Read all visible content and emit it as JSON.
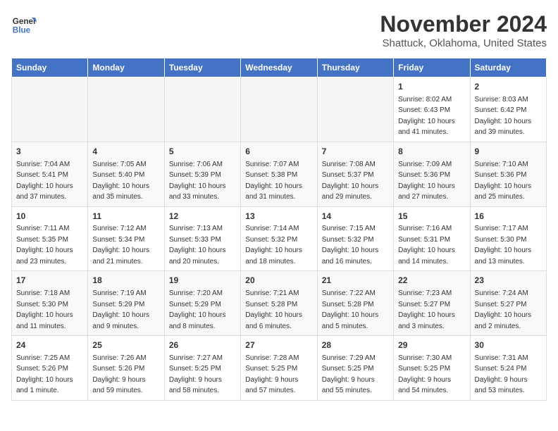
{
  "header": {
    "logo_line1": "General",
    "logo_line2": "Blue",
    "month": "November 2024",
    "location": "Shattuck, Oklahoma, United States"
  },
  "weekdays": [
    "Sunday",
    "Monday",
    "Tuesday",
    "Wednesday",
    "Thursday",
    "Friday",
    "Saturday"
  ],
  "weeks": [
    [
      {
        "day": "",
        "info": ""
      },
      {
        "day": "",
        "info": ""
      },
      {
        "day": "",
        "info": ""
      },
      {
        "day": "",
        "info": ""
      },
      {
        "day": "",
        "info": ""
      },
      {
        "day": "1",
        "info": "Sunrise: 8:02 AM\nSunset: 6:43 PM\nDaylight: 10 hours\nand 41 minutes."
      },
      {
        "day": "2",
        "info": "Sunrise: 8:03 AM\nSunset: 6:42 PM\nDaylight: 10 hours\nand 39 minutes."
      }
    ],
    [
      {
        "day": "3",
        "info": "Sunrise: 7:04 AM\nSunset: 5:41 PM\nDaylight: 10 hours\nand 37 minutes."
      },
      {
        "day": "4",
        "info": "Sunrise: 7:05 AM\nSunset: 5:40 PM\nDaylight: 10 hours\nand 35 minutes."
      },
      {
        "day": "5",
        "info": "Sunrise: 7:06 AM\nSunset: 5:39 PM\nDaylight: 10 hours\nand 33 minutes."
      },
      {
        "day": "6",
        "info": "Sunrise: 7:07 AM\nSunset: 5:38 PM\nDaylight: 10 hours\nand 31 minutes."
      },
      {
        "day": "7",
        "info": "Sunrise: 7:08 AM\nSunset: 5:37 PM\nDaylight: 10 hours\nand 29 minutes."
      },
      {
        "day": "8",
        "info": "Sunrise: 7:09 AM\nSunset: 5:36 PM\nDaylight: 10 hours\nand 27 minutes."
      },
      {
        "day": "9",
        "info": "Sunrise: 7:10 AM\nSunset: 5:36 PM\nDaylight: 10 hours\nand 25 minutes."
      }
    ],
    [
      {
        "day": "10",
        "info": "Sunrise: 7:11 AM\nSunset: 5:35 PM\nDaylight: 10 hours\nand 23 minutes."
      },
      {
        "day": "11",
        "info": "Sunrise: 7:12 AM\nSunset: 5:34 PM\nDaylight: 10 hours\nand 21 minutes."
      },
      {
        "day": "12",
        "info": "Sunrise: 7:13 AM\nSunset: 5:33 PM\nDaylight: 10 hours\nand 20 minutes."
      },
      {
        "day": "13",
        "info": "Sunrise: 7:14 AM\nSunset: 5:32 PM\nDaylight: 10 hours\nand 18 minutes."
      },
      {
        "day": "14",
        "info": "Sunrise: 7:15 AM\nSunset: 5:32 PM\nDaylight: 10 hours\nand 16 minutes."
      },
      {
        "day": "15",
        "info": "Sunrise: 7:16 AM\nSunset: 5:31 PM\nDaylight: 10 hours\nand 14 minutes."
      },
      {
        "day": "16",
        "info": "Sunrise: 7:17 AM\nSunset: 5:30 PM\nDaylight: 10 hours\nand 13 minutes."
      }
    ],
    [
      {
        "day": "17",
        "info": "Sunrise: 7:18 AM\nSunset: 5:30 PM\nDaylight: 10 hours\nand 11 minutes."
      },
      {
        "day": "18",
        "info": "Sunrise: 7:19 AM\nSunset: 5:29 PM\nDaylight: 10 hours\nand 9 minutes."
      },
      {
        "day": "19",
        "info": "Sunrise: 7:20 AM\nSunset: 5:29 PM\nDaylight: 10 hours\nand 8 minutes."
      },
      {
        "day": "20",
        "info": "Sunrise: 7:21 AM\nSunset: 5:28 PM\nDaylight: 10 hours\nand 6 minutes."
      },
      {
        "day": "21",
        "info": "Sunrise: 7:22 AM\nSunset: 5:28 PM\nDaylight: 10 hours\nand 5 minutes."
      },
      {
        "day": "22",
        "info": "Sunrise: 7:23 AM\nSunset: 5:27 PM\nDaylight: 10 hours\nand 3 minutes."
      },
      {
        "day": "23",
        "info": "Sunrise: 7:24 AM\nSunset: 5:27 PM\nDaylight: 10 hours\nand 2 minutes."
      }
    ],
    [
      {
        "day": "24",
        "info": "Sunrise: 7:25 AM\nSunset: 5:26 PM\nDaylight: 10 hours\nand 1 minute."
      },
      {
        "day": "25",
        "info": "Sunrise: 7:26 AM\nSunset: 5:26 PM\nDaylight: 9 hours\nand 59 minutes."
      },
      {
        "day": "26",
        "info": "Sunrise: 7:27 AM\nSunset: 5:25 PM\nDaylight: 9 hours\nand 58 minutes."
      },
      {
        "day": "27",
        "info": "Sunrise: 7:28 AM\nSunset: 5:25 PM\nDaylight: 9 hours\nand 57 minutes."
      },
      {
        "day": "28",
        "info": "Sunrise: 7:29 AM\nSunset: 5:25 PM\nDaylight: 9 hours\nand 55 minutes."
      },
      {
        "day": "29",
        "info": "Sunrise: 7:30 AM\nSunset: 5:25 PM\nDaylight: 9 hours\nand 54 minutes."
      },
      {
        "day": "30",
        "info": "Sunrise: 7:31 AM\nSunset: 5:24 PM\nDaylight: 9 hours\nand 53 minutes."
      }
    ]
  ]
}
